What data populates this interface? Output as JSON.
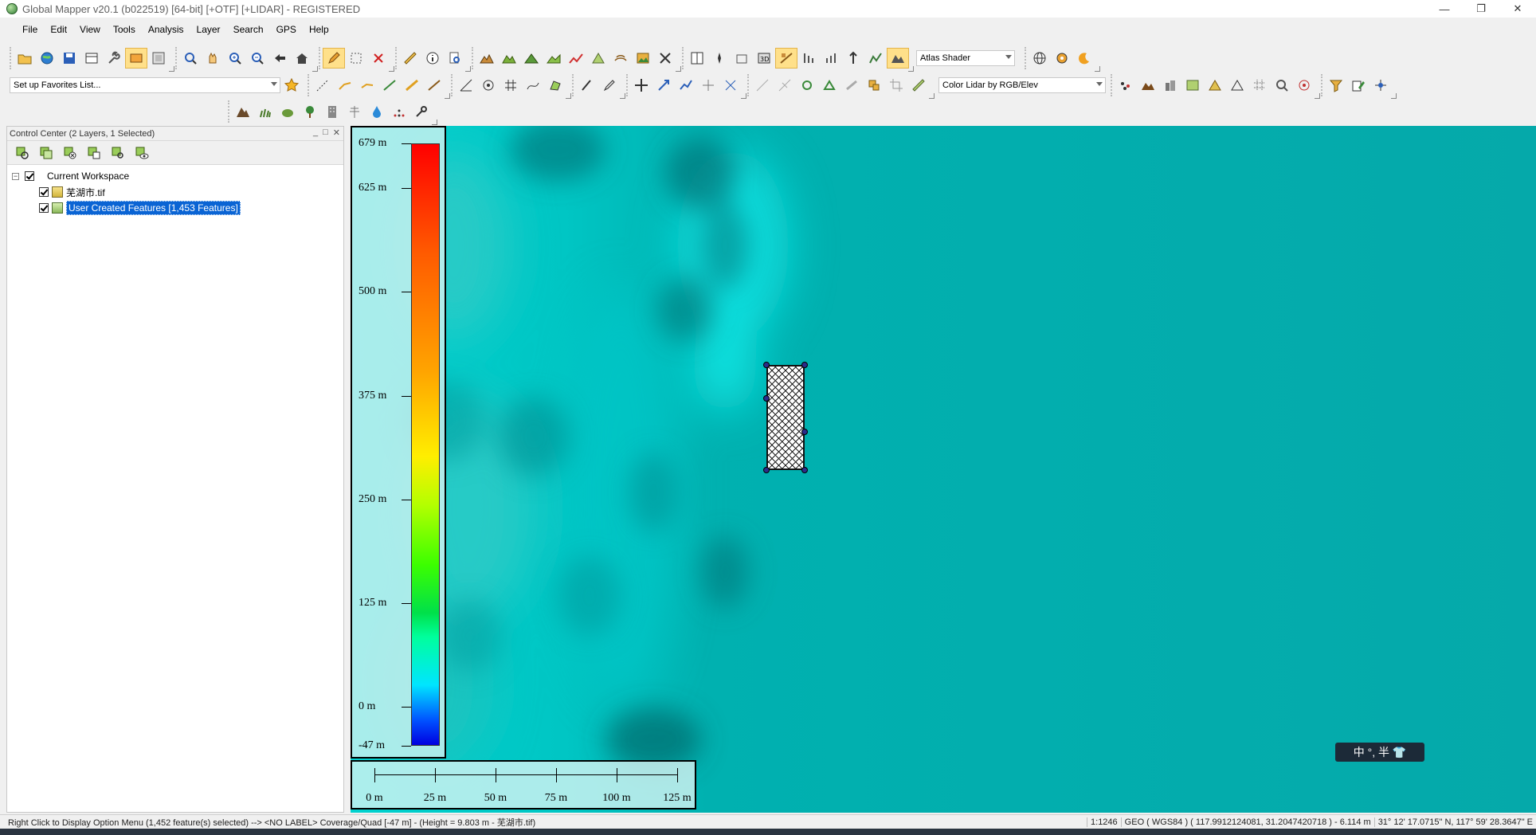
{
  "window": {
    "title": "Global Mapper v20.1 (b022519) [64-bit] [+OTF] [+LIDAR] - REGISTERED",
    "controls": [
      "—",
      "❐",
      "✕"
    ]
  },
  "menu": [
    "File",
    "Edit",
    "View",
    "Tools",
    "Analysis",
    "Layer",
    "Search",
    "GPS",
    "Help"
  ],
  "toolbar": {
    "shader_value": "Atlas Shader",
    "favorites_value": "Set up Favorites List...",
    "lidar_color_value": "Color Lidar by RGB/Elev"
  },
  "control_center": {
    "title": "Control Center (2 Layers, 1 Selected)",
    "header_buttons": [
      "_",
      "□",
      "✕"
    ],
    "workspace_label": "Current Workspace",
    "layers": [
      {
        "name": "芜湖市.tif",
        "checked": true
      },
      {
        "name": "User Created Features [1,453 Features]",
        "checked": true,
        "selected": true
      }
    ]
  },
  "legend": {
    "ticks": [
      {
        "label": "679 m",
        "value": 679
      },
      {
        "label": "625 m",
        "value": 625
      },
      {
        "label": "500 m",
        "value": 500
      },
      {
        "label": "375 m",
        "value": 375
      },
      {
        "label": "250 m",
        "value": 250
      },
      {
        "label": "125 m",
        "value": 125
      },
      {
        "label": "0 m",
        "value": 0
      },
      {
        "label": "-47 m",
        "value": -47
      }
    ]
  },
  "scale": {
    "ticks": [
      {
        "label": "0 m",
        "value": 0
      },
      {
        "label": "25 m",
        "value": 25
      },
      {
        "label": "50 m",
        "value": 50
      },
      {
        "label": "75 m",
        "value": 75
      },
      {
        "label": "100 m",
        "value": 100
      },
      {
        "label": "125 m",
        "value": 125
      }
    ]
  },
  "ime": {
    "label": "中 °, 半 👕"
  },
  "status": {
    "message": "Right Click to Display Option Menu (1,452 feature(s) selected) --> <NO LABEL> Coverage/Quad [-47 m] - (Height = 9.803 m - 芜湖市.tif)",
    "scale": "1:1246",
    "projection": "GEO ( WGS84 ) ( 117.9912124081, 31.2047420718 ) - 6.114 m",
    "coords": "31° 12' 17.0715\" N, 117° 59' 28.3647\" E"
  },
  "colors": {
    "map_background": "#05a9aa",
    "selection": "#0a64d4"
  }
}
